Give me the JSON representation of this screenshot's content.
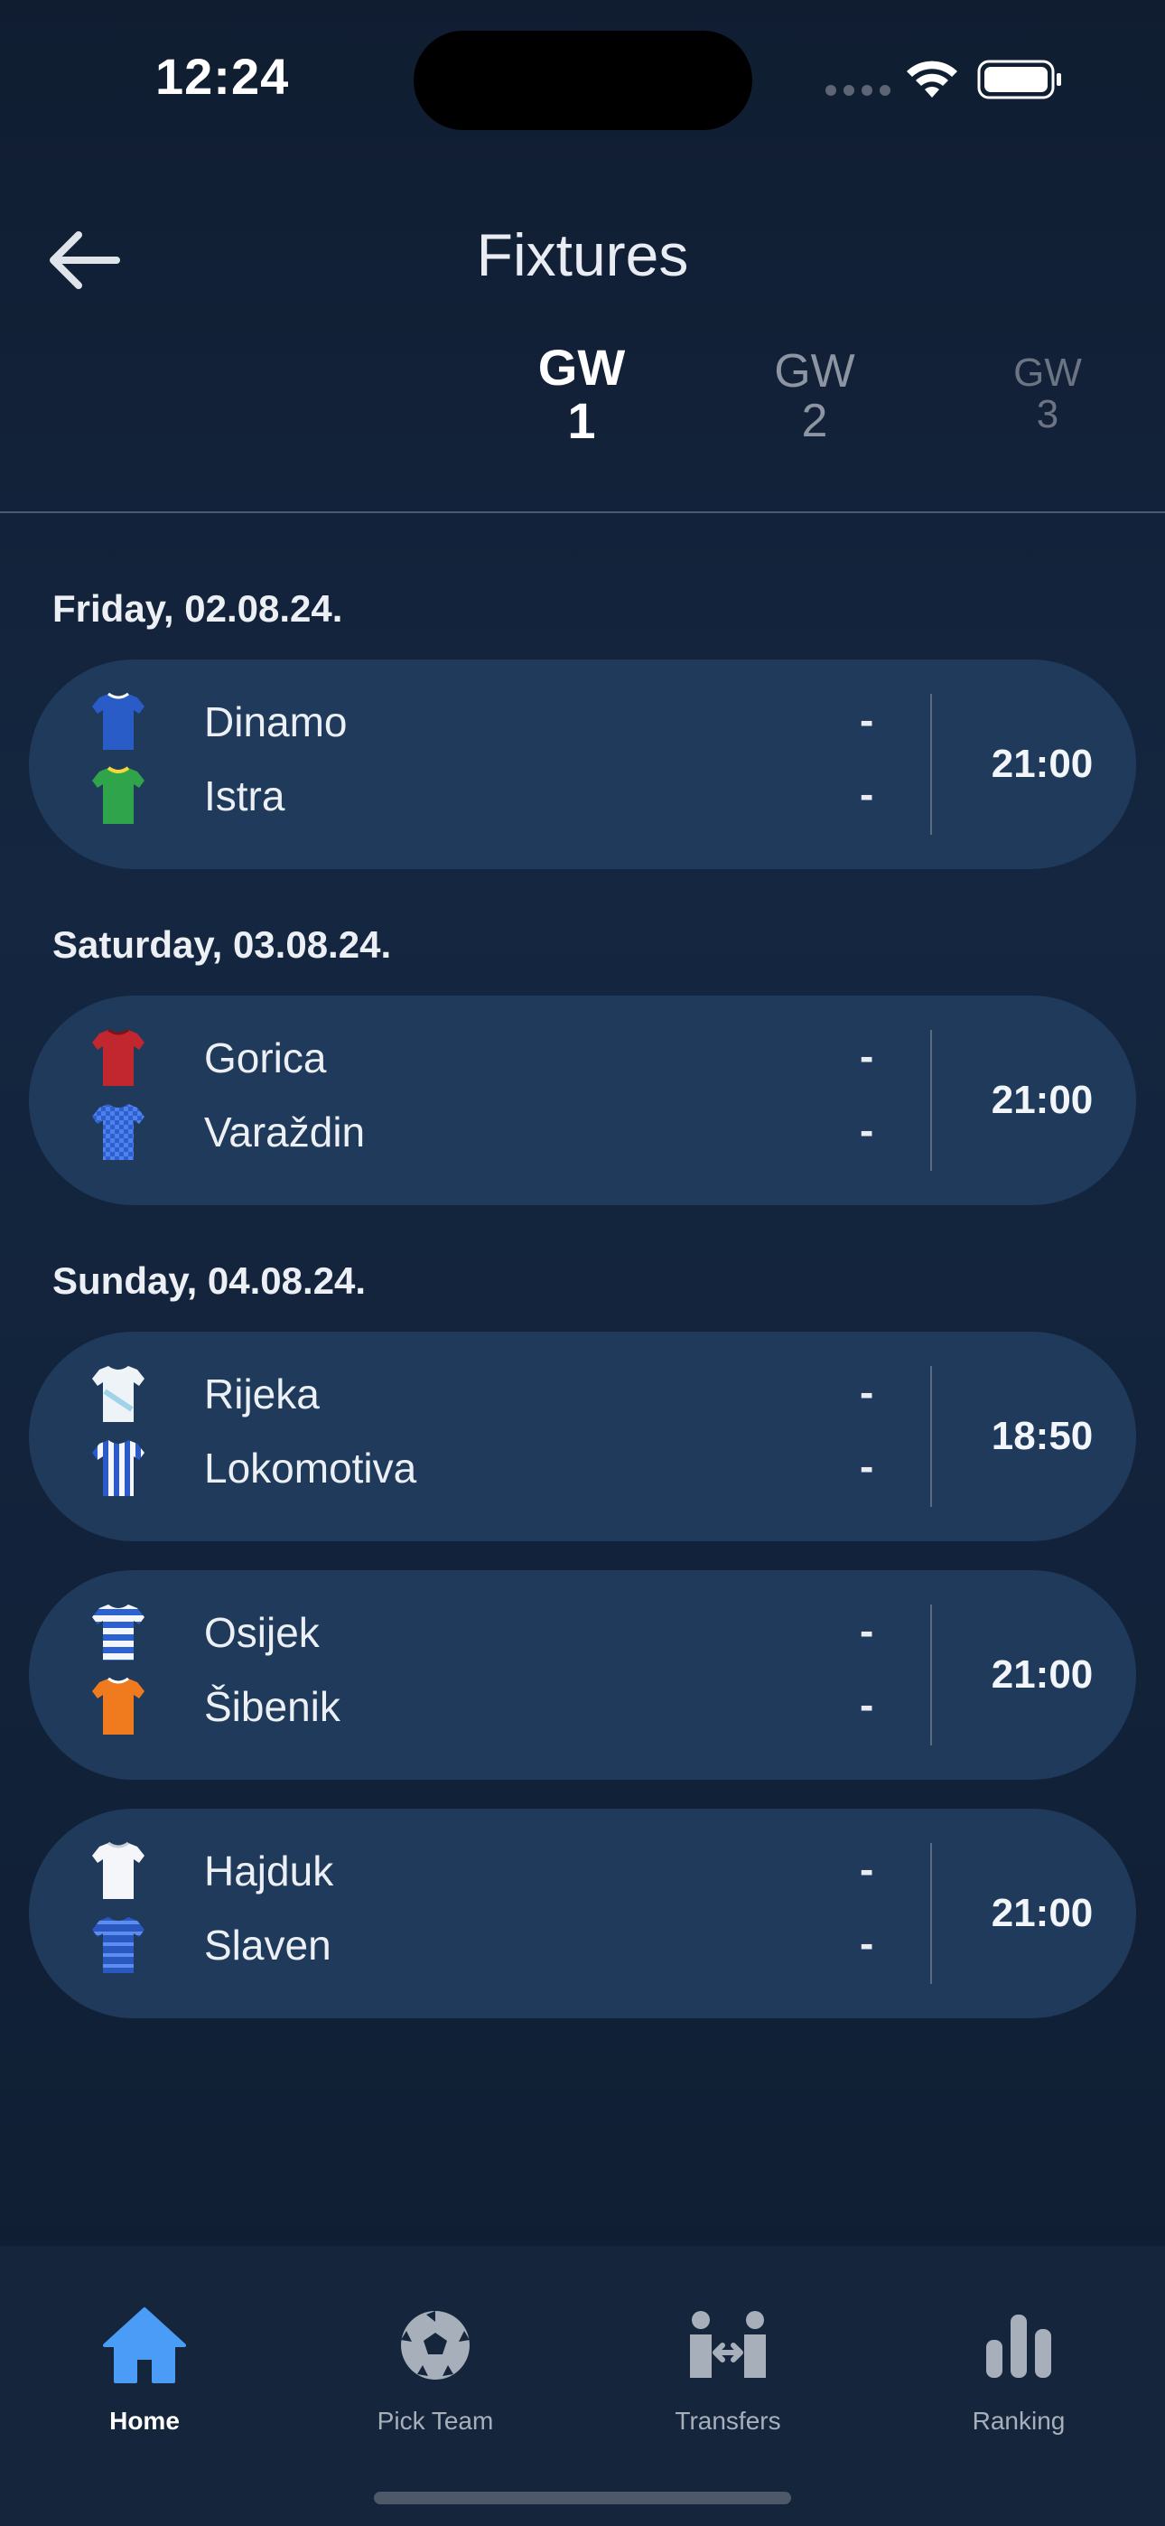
{
  "status": {
    "time": "12:24"
  },
  "header": {
    "title": "Fixtures"
  },
  "gameweeks": [
    {
      "gw": "GW",
      "num": "1",
      "active": true
    },
    {
      "gw": "GW",
      "num": "2",
      "active": false
    },
    {
      "gw": "GW",
      "num": "3",
      "active": false
    }
  ],
  "days": [
    {
      "label": "Friday, 02.08.24."
    },
    {
      "label": "Saturday, 03.08.24."
    },
    {
      "label": "Sunday, 04.08.24."
    }
  ],
  "matches": [
    {
      "home": "Dinamo",
      "away": "Istra",
      "home_score": "-",
      "away_score": "-",
      "time": "21:00",
      "home_kit": "blue-kit-icon",
      "away_kit": "green-yellow-kit-icon"
    },
    {
      "home": "Gorica",
      "away": "Varaždin",
      "home_score": "-",
      "away_score": "-",
      "time": "21:00",
      "home_kit": "red-kit-icon",
      "away_kit": "blue-checked-kit-icon"
    },
    {
      "home": "Rijeka",
      "away": "Lokomotiva",
      "home_score": "-",
      "away_score": "-",
      "time": "18:50",
      "home_kit": "white-kit-icon",
      "away_kit": "blue-white-stripes-kit-icon"
    },
    {
      "home": "Osijek",
      "away": "Šibenik",
      "home_score": "-",
      "away_score": "-",
      "time": "21:00",
      "home_kit": "white-blue-hoops-kit-icon",
      "away_kit": "orange-kit-icon"
    },
    {
      "home": "Hajduk",
      "away": "Slaven",
      "home_score": "-",
      "away_score": "-",
      "time": "21:00",
      "home_kit": "white-kit-icon",
      "away_kit": "blue-hoops-kit-icon"
    }
  ],
  "nav": [
    {
      "label": "Home",
      "icon": "home-icon",
      "active": true
    },
    {
      "label": "Pick Team",
      "icon": "soccer-ball-icon",
      "active": false
    },
    {
      "label": "Transfers",
      "icon": "transfers-icon",
      "active": false
    },
    {
      "label": "Ranking",
      "icon": "bar-chart-icon",
      "active": false
    }
  ],
  "colors": {
    "background": "#122239",
    "card": "#1f3a5a",
    "accent": "#4a9cf6",
    "nav_background": "#15253b"
  }
}
